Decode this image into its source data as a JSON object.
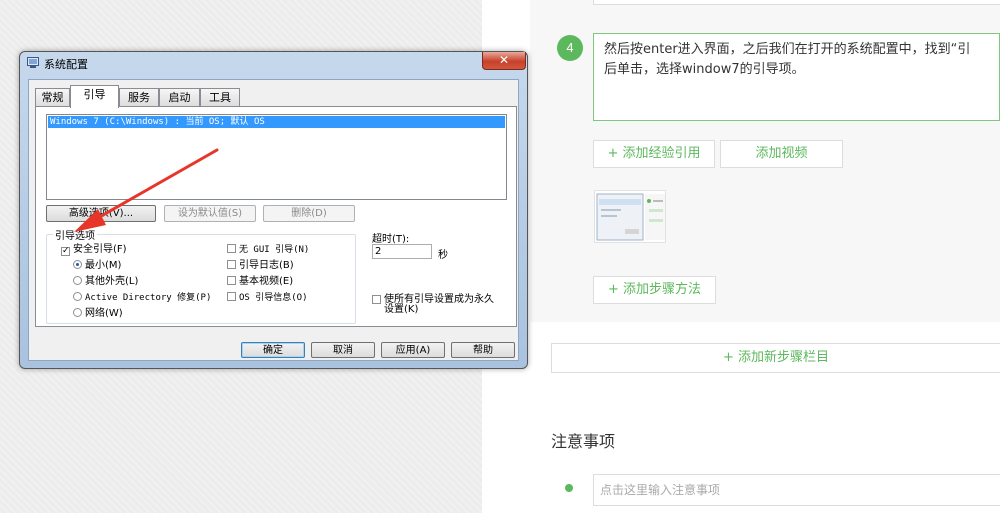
{
  "webpage": {
    "step": {
      "number": "4",
      "text": "然后按enter进入界面，之后我们在打开的系统配置中，找到“引\n后单击，选择window7的引导项。"
    },
    "buttons": {
      "add_reference": "+ 添加经验引用",
      "add_video": "添加视频",
      "add_step_method": "+ 添加步骤方法",
      "add_new_section": "+ 添加新步骤栏目"
    },
    "notes": {
      "title": "注意事项",
      "placeholder": "点击这里输入注意事项"
    }
  },
  "dialog": {
    "title": "系统配置",
    "close": "✕",
    "tabs": [
      "常规",
      "引导",
      "服务",
      "启动",
      "工具"
    ],
    "active_tab": "引导",
    "os_entry": "Windows 7 (C:\\Windows) : 当前 OS; 默认 OS",
    "btn_advanced": "高级选项(V)...",
    "btn_set_default": "设为默认值(S)",
    "btn_delete": "删除(D)",
    "boot_options_label": "引导选项",
    "safe_boot": "安全引导(F)",
    "minimal": "最小(M)",
    "alternate_shell": "其他外壳(L)",
    "ad_repair": "Active Directory 修复(P)",
    "network": "网络(W)",
    "no_gui": "无 GUI 引导(N)",
    "boot_log": "引导日志(B)",
    "base_video": "基本视频(E)",
    "os_boot_info": "OS 引导信息(O)",
    "timeout_label": "超时(T):",
    "timeout_value": "2",
    "timeout_unit": "秒",
    "permanent": "使所有引导设置成为永久\n设置(K)",
    "ok": "确定",
    "cancel": "取消",
    "apply": "应用(A)",
    "help": "帮助"
  },
  "colors": {
    "accent_green": "#5cb85c",
    "selection_blue": "#3399ff",
    "arrow_red": "#e8352a"
  }
}
